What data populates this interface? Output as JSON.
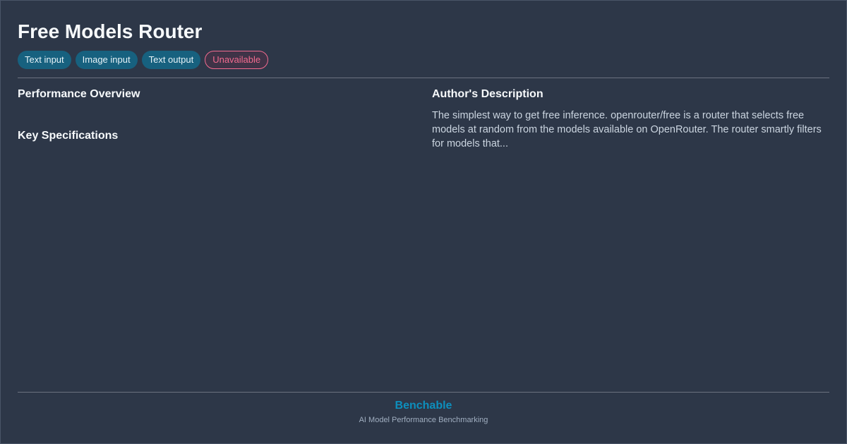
{
  "model": {
    "title": "Free Models Router"
  },
  "badges": [
    {
      "label": "Text input",
      "kind": "capability"
    },
    {
      "label": "Image input",
      "kind": "capability"
    },
    {
      "label": "Text output",
      "kind": "capability"
    },
    {
      "label": "Unavailable",
      "kind": "status"
    }
  ],
  "sections": {
    "performance_heading": "Performance Overview",
    "specs_heading": "Key Specifications",
    "author_heading": "Author's Description",
    "author_description": "The simplest way to get free inference. openrouter/free is a router that selects free models at random from the models available on OpenRouter. The router smartly filters for models that..."
  },
  "footer": {
    "brand": "Benchable",
    "tagline": "AI Model Performance Benchmarking"
  },
  "colors": {
    "background": "#2d3748",
    "capability_badge": "#17617f",
    "status_badge_accent": "#f26b8f",
    "brand_accent": "#0d8fbd"
  }
}
